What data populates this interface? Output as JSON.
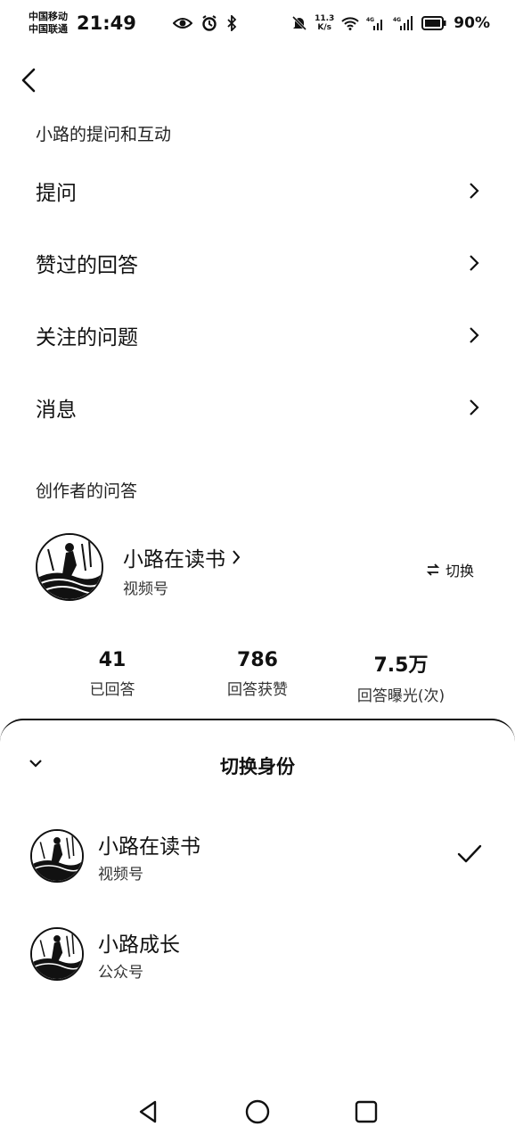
{
  "status_bar": {
    "carrier_1": "中国移动",
    "carrier_2": "中国联通",
    "time": "21:49",
    "net_speed_value": "11.3",
    "net_speed_unit": "K/s",
    "battery": "90%"
  },
  "personal": {
    "section_title": "小路的提问和互动",
    "items": [
      {
        "label": "提问"
      },
      {
        "label": "赞过的回答"
      },
      {
        "label": "关注的问题"
      },
      {
        "label": "消息"
      }
    ]
  },
  "creator": {
    "section_title": "创作者的问答",
    "name": "小路在读书",
    "type": "视频号",
    "switch_label": "切换",
    "stats": [
      {
        "value": "41",
        "label": "已回答"
      },
      {
        "value": "786",
        "label": "回答获赞"
      },
      {
        "value": "7.5万",
        "label": "回答曝光(次)"
      }
    ]
  },
  "sheet": {
    "title": "切换身份",
    "identities": [
      {
        "name": "小路在读书",
        "type": "视频号",
        "selected": true
      },
      {
        "name": "小路成长",
        "type": "公众号",
        "selected": false
      }
    ]
  }
}
